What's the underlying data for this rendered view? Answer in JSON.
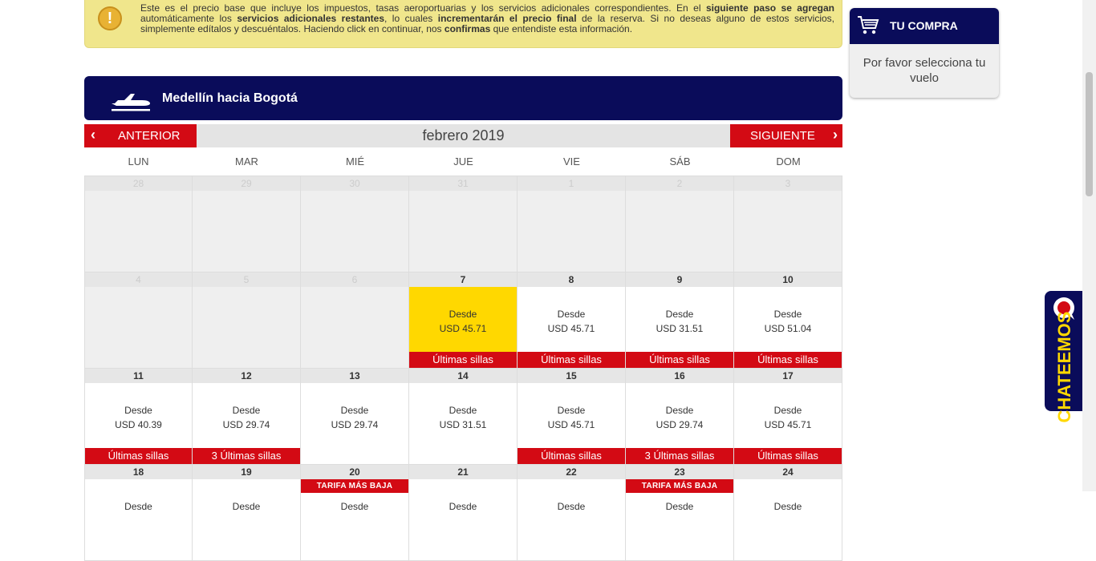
{
  "notice": {
    "p1": "Este es el precio base que incluye los impuestos, tasas aeroportuarias y los servicios adicionales correspondientes. En el ",
    "b1": "siguiente paso se agregan",
    "p2": " automáticamente los ",
    "b2": "servicios adicionales restantes",
    "p3": ", lo cuales ",
    "b3": "incrementarán el precio final",
    "p4": " de la reserva. Si no deseas alguno de estos servicios, simplemente edítalos y descuéntalos. Haciendo click en continuar, nos ",
    "b4": "confirmas",
    "p5": " que entendiste esta información.",
    "icon": "warning-icon"
  },
  "route": {
    "title": "Medellín hacia Bogotá",
    "icon": "plane-icon"
  },
  "nav": {
    "prev": "ANTERIOR",
    "next": "SIGUIENTE",
    "month": "febrero 2019"
  },
  "weekdays": [
    "LUN",
    "MAR",
    "MIÉ",
    "JUE",
    "VIE",
    "SÁB",
    "DOM"
  ],
  "labels": {
    "desde": "Desde",
    "tarifa": "TARIFA MÁS BAJA"
  },
  "weeks": [
    [
      {
        "day": "28",
        "out": true
      },
      {
        "day": "29",
        "out": true
      },
      {
        "day": "30",
        "out": true
      },
      {
        "day": "31",
        "out": true
      },
      {
        "day": "1",
        "out": true
      },
      {
        "day": "2",
        "out": true
      },
      {
        "day": "3",
        "out": true
      }
    ],
    [
      {
        "day": "4",
        "out": true
      },
      {
        "day": "5",
        "out": true
      },
      {
        "day": "6",
        "out": true
      },
      {
        "day": "7",
        "price": "USD 45.71",
        "badge": "Últimas sillas",
        "selected": true
      },
      {
        "day": "8",
        "price": "USD 45.71",
        "badge": "Últimas sillas"
      },
      {
        "day": "9",
        "price": "USD 31.51",
        "badge": "Últimas sillas"
      },
      {
        "day": "10",
        "price": "USD 51.04",
        "badge": "Últimas sillas"
      }
    ],
    [
      {
        "day": "11",
        "price": "USD 40.39",
        "badge": "Últimas sillas"
      },
      {
        "day": "12",
        "price": "USD 29.74",
        "badge": "3 Últimas sillas"
      },
      {
        "day": "13",
        "price": "USD 29.74"
      },
      {
        "day": "14",
        "price": "USD 31.51"
      },
      {
        "day": "15",
        "price": "USD 45.71",
        "badge": "Últimas sillas"
      },
      {
        "day": "16",
        "price": "USD 29.74",
        "badge": "3 Últimas sillas"
      },
      {
        "day": "17",
        "price": "USD 45.71",
        "badge": "Últimas sillas"
      }
    ],
    [
      {
        "day": "18",
        "price": ""
      },
      {
        "day": "19",
        "price": ""
      },
      {
        "day": "20",
        "price": "",
        "tarifa": true
      },
      {
        "day": "21",
        "price": ""
      },
      {
        "day": "22",
        "price": ""
      },
      {
        "day": "23",
        "price": "",
        "tarifa": true
      },
      {
        "day": "24",
        "price": ""
      }
    ]
  ],
  "purchase": {
    "title": "TU COMPRA",
    "message": "Por favor selecciona tu vuelo",
    "icon": "cart-icon"
  },
  "chat": {
    "label": "CHATEEMOS",
    "icon": "chat-bubble-icon"
  },
  "colors": {
    "navy": "#0a0c5a",
    "red": "#d30a14",
    "yellow": "#ffd800",
    "notice": "#f0e68c"
  }
}
